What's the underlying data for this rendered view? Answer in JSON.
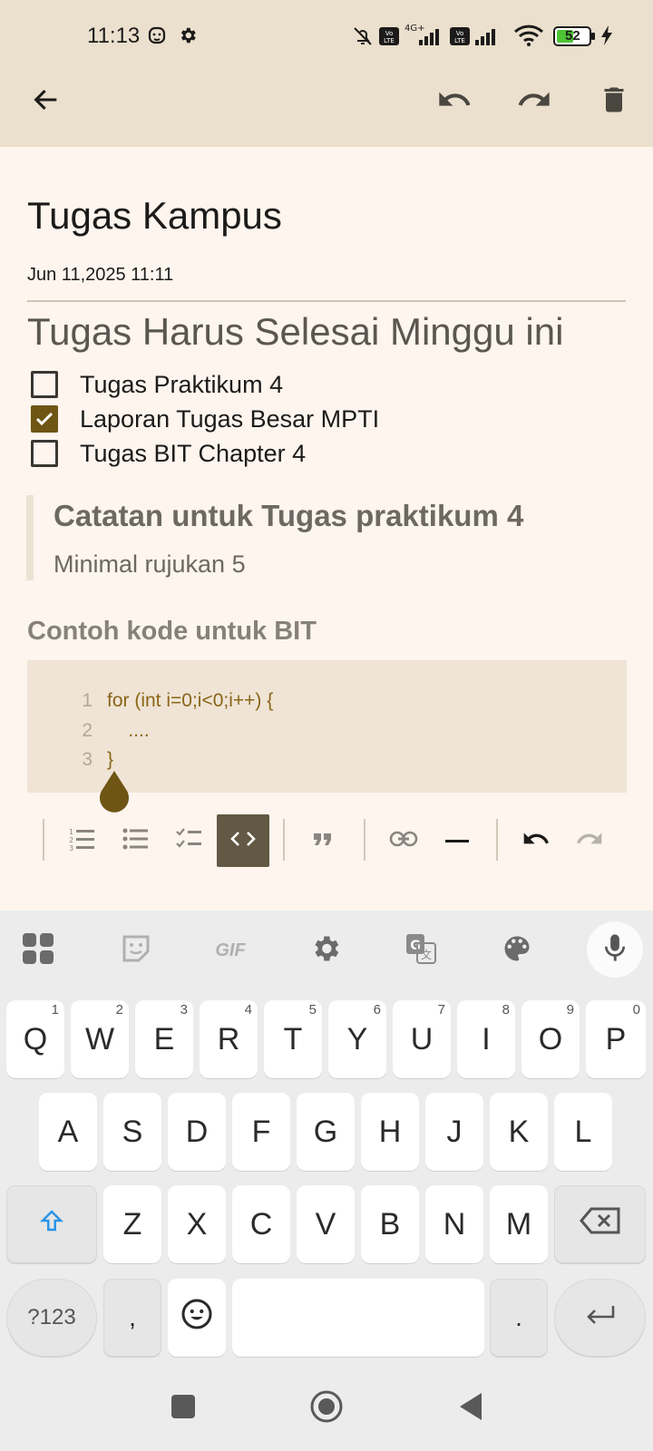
{
  "status_bar": {
    "time": "11:13",
    "battery": "52",
    "network": "4G+",
    "icons": [
      "mute-bell-icon",
      "volte-icon",
      "signal-icon",
      "wifi-icon",
      "battery-icon",
      "charging-icon"
    ]
  },
  "app_bar": {
    "icons": [
      "back-arrow-icon",
      "undo-icon",
      "redo-icon",
      "trash-icon"
    ]
  },
  "note": {
    "title": "Tugas Kampus",
    "date": "Jun 11,2025 11:11",
    "heading": "Tugas Harus Selesai Minggu ini",
    "checklist": [
      {
        "label": "Tugas Praktikum 4",
        "checked": false
      },
      {
        "label": "Laporan Tugas Besar MPTI",
        "checked": true
      },
      {
        "label": "Tugas BIT Chapter 4",
        "checked": false
      }
    ],
    "quote": {
      "heading": "Catatan untuk Tugas praktikum 4",
      "text": "Minimal rujukan 5"
    },
    "subheading": "Contoh kode untuk BIT",
    "code_lines": [
      {
        "num": "1",
        "text": "for (int i=0;i<0;i++) {"
      },
      {
        "num": "2",
        "text": "    ...."
      },
      {
        "num": "3",
        "text": "}"
      }
    ]
  },
  "format_toolbar": {
    "buttons": [
      "ordered-list-icon",
      "bullet-list-icon",
      "check-list-icon",
      "code-icon",
      "quote-icon",
      "link-icon",
      "horizontal-rule-icon",
      "undo-icon",
      "redo-icon"
    ],
    "active": "code-icon"
  },
  "keyboard": {
    "toolbar": [
      "apps-grid-icon",
      "sticker-icon",
      "GIF",
      "settings-icon",
      "translate-icon",
      "palette-icon",
      "mic-icon"
    ],
    "row1": [
      {
        "k": "Q",
        "h": "1"
      },
      {
        "k": "W",
        "h": "2"
      },
      {
        "k": "E",
        "h": "3"
      },
      {
        "k": "R",
        "h": "4"
      },
      {
        "k": "T",
        "h": "5"
      },
      {
        "k": "Y",
        "h": "6"
      },
      {
        "k": "U",
        "h": "7"
      },
      {
        "k": "I",
        "h": "8"
      },
      {
        "k": "O",
        "h": "9"
      },
      {
        "k": "P",
        "h": "0"
      }
    ],
    "row2": [
      "A",
      "S",
      "D",
      "F",
      "G",
      "H",
      "J",
      "K",
      "L"
    ],
    "row3": [
      "Z",
      "X",
      "C",
      "V",
      "B",
      "N",
      "M"
    ],
    "symbols_label": "?123",
    "comma": ",",
    "period": "."
  },
  "colors": {
    "app_bar": "#ebe0cd",
    "background": "#fdf5ee",
    "accent": "#6e5514",
    "code_text": "#8a6518",
    "toolbar_active": "#625844"
  }
}
